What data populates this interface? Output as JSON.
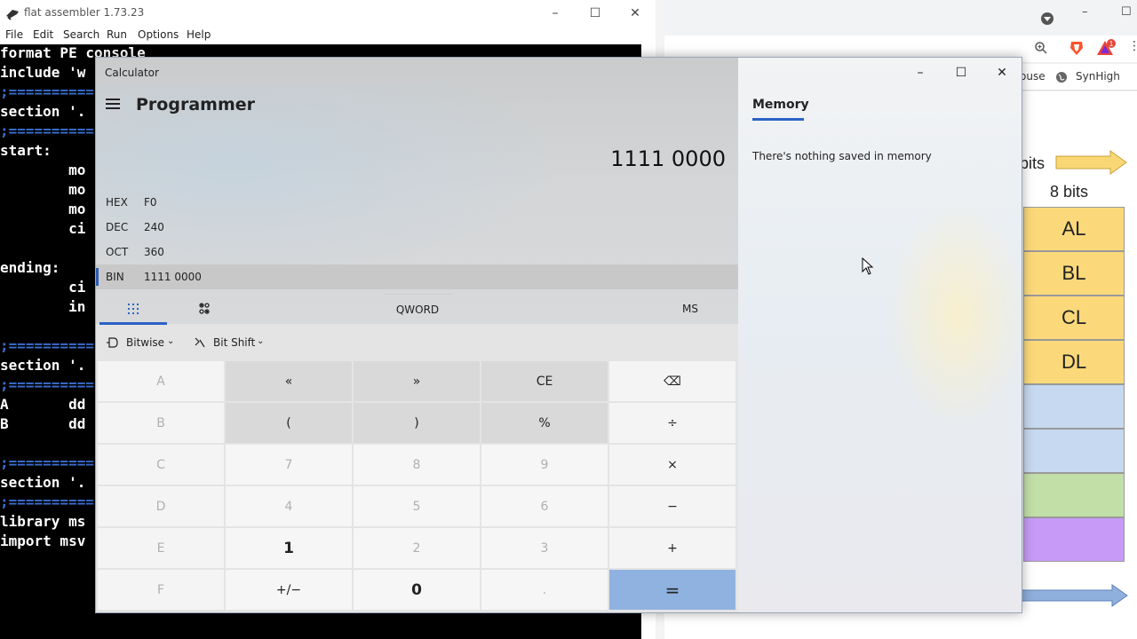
{
  "fasm": {
    "title": "flat assembler 1.73.23",
    "menu": [
      "File",
      "Edit",
      "Search",
      "Run",
      "Options",
      "Help"
    ],
    "code_lines": [
      "format PE console",
      "include 'w",
      ";==========",
      "section '.",
      ";==========",
      "start:",
      "        mo",
      "        mo",
      "        mo",
      "        ci",
      "",
      "ending:",
      "        ci",
      "        in",
      "",
      ";==========",
      "section '.",
      ";==========",
      "A       dd",
      "B       dd",
      "",
      ";==========",
      "section '.",
      ";==========",
      "library ms",
      "import msv"
    ]
  },
  "browser": {
    "bookmark_items": [
      "ouse",
      "SynHigh"
    ],
    "notification_badge": "1",
    "diagram": {
      "top_label_partial": "bits",
      "col_label": "8 bits",
      "registers": [
        "AL",
        "BL",
        "CL",
        "DL"
      ],
      "colors": {
        "yellow": "#fbd97a",
        "blue": "#c6d9f0",
        "green": "#c2dfa8",
        "purple": "#c79af7",
        "arrow_yellow": "#f9d774",
        "arrow_blue": "#8fb0dc"
      }
    }
  },
  "calc": {
    "window_title": "Calculator",
    "mode": "Programmer",
    "display_value": "1111 0000",
    "radix": [
      {
        "label": "HEX",
        "value": "F0"
      },
      {
        "label": "DEC",
        "value": "240"
      },
      {
        "label": "OCT",
        "value": "360"
      },
      {
        "label": "BIN",
        "value": "1111 0000",
        "active": true
      }
    ],
    "word_size": "QWORD",
    "memory_store": "MS",
    "bitwise_label": "Bitwise",
    "bitshift_label": "Bit Shift",
    "keys": [
      [
        "A",
        "«",
        "»",
        "CE",
        "⌫"
      ],
      [
        "B",
        "(",
        ")",
        "%",
        "÷"
      ],
      [
        "C",
        "7",
        "8",
        "9",
        "×"
      ],
      [
        "D",
        "4",
        "5",
        "6",
        "−"
      ],
      [
        "E",
        "1",
        "2",
        "3",
        "+"
      ],
      [
        "F",
        "+/−",
        "0",
        ".",
        "="
      ]
    ],
    "memory": {
      "tab_label": "Memory",
      "empty_message": "There's nothing saved in memory"
    },
    "accent_color": "#2b63c6"
  }
}
